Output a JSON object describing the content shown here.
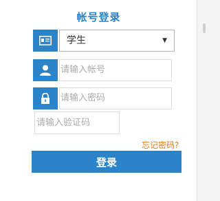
{
  "form": {
    "title": "帐号登录",
    "role_select": {
      "selected": "学生"
    },
    "username": {
      "placeholder": "请输入帐号"
    },
    "password": {
      "placeholder": "请输入密码"
    },
    "captcha": {
      "placeholder": "请输入验证码"
    },
    "forgot_link": "忘记密码?",
    "login_button": "登录"
  },
  "colors": {
    "accent": "#2b83c9",
    "forgot": "#e07a1a"
  },
  "icons": {
    "role": "id-card-icon",
    "username": "user-icon",
    "password": "lock-icon"
  }
}
